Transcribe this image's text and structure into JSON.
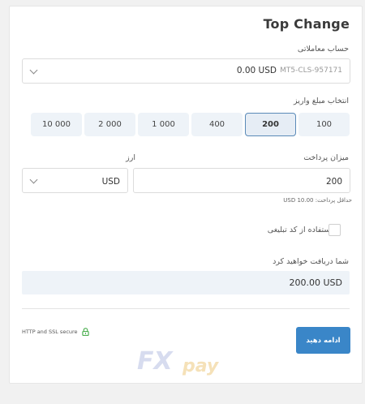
{
  "form": {
    "title": "Top Change",
    "account_label": "حساب معاملاتی",
    "account_number": "MT5-CLS-957171",
    "account_balance": "0.00 USD",
    "amount_label": "انتخاب مبلغ واریز",
    "amounts": [
      "100",
      "200",
      "400",
      "1 000",
      "2 000",
      "10 000"
    ],
    "selected_amount": "200",
    "payment_label": "میزان پرداخت",
    "payment_value": "200",
    "currency_label": "ارز",
    "currency_value": "USD",
    "min_payment_note": "حداقل پرداخت: 10.00 USD",
    "promo_label": "استفاده از کد تبلیغی",
    "receive_label": "شما دریافت خواهید کرد",
    "receive_value": "200.00 USD",
    "secure_text": "HTTP and SSL secure",
    "submit_label": "ادامه دهید"
  },
  "brand": {
    "fx": "FX",
    "pay": "pay"
  },
  "colors": {
    "accent": "#3a86c8",
    "selected_border": "#5a8ab8",
    "secure_lock": "#4caf50",
    "panel_bg": "#eef3f8"
  }
}
